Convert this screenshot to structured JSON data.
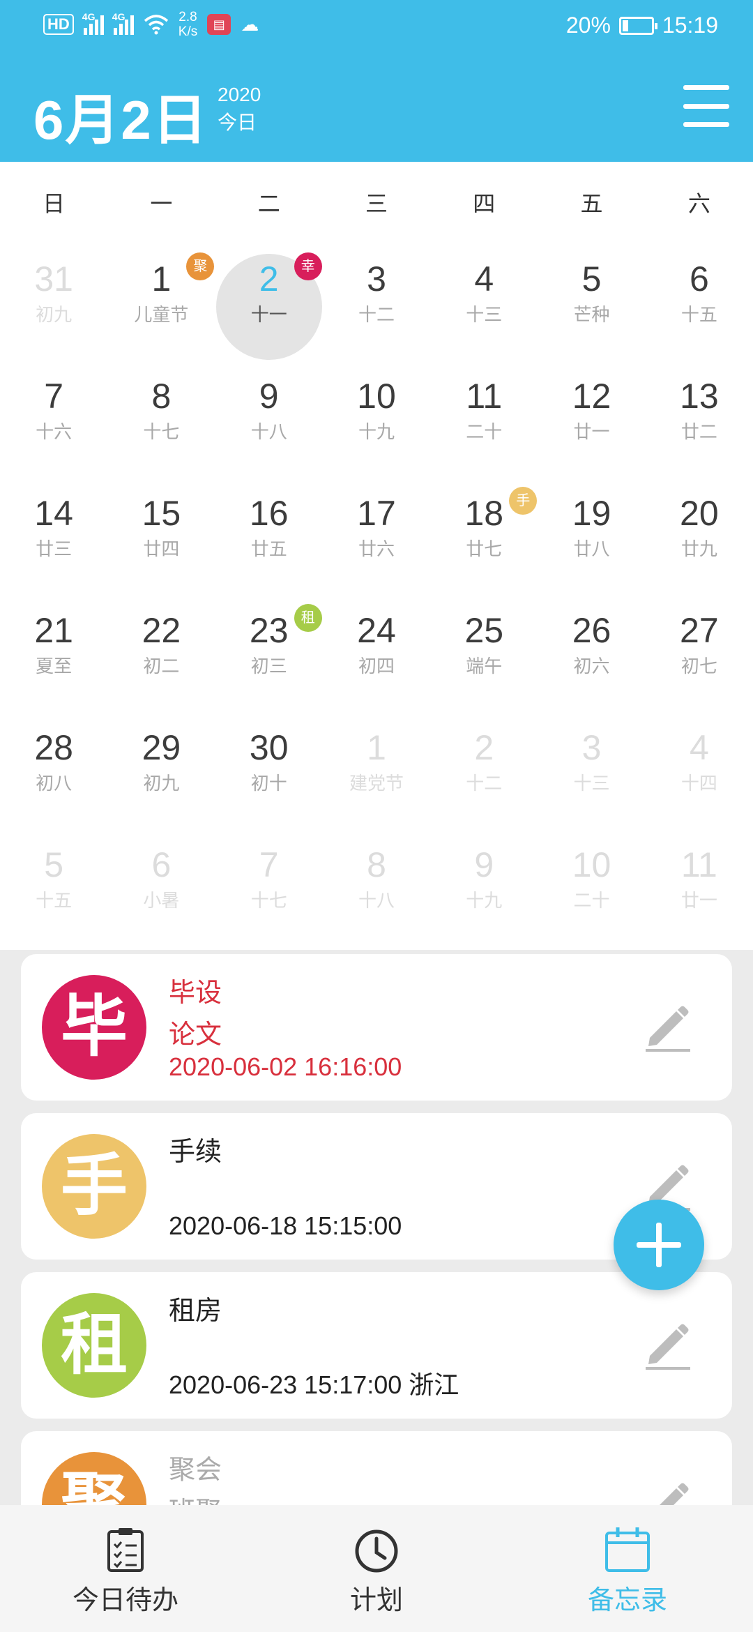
{
  "status_bar": {
    "hd": "HD",
    "net1": "4G",
    "net2": "4G",
    "speed_value": "2.8",
    "speed_unit": "K/s",
    "battery": "20%",
    "battery_level": 0.2,
    "time": "15:19"
  },
  "header": {
    "date": "6月2日",
    "year": "2020",
    "today_label": "今日"
  },
  "calendar": {
    "weekdays": [
      "日",
      "一",
      "二",
      "三",
      "四",
      "五",
      "六"
    ],
    "days": [
      {
        "num": "31",
        "lunar": "初九",
        "dim": true
      },
      {
        "num": "1",
        "lunar": "儿童节",
        "badge": "聚",
        "badge_color": "#e8933a"
      },
      {
        "num": "2",
        "lunar": "十一",
        "today": true,
        "badge": "幸",
        "badge_color": "#d81e5b"
      },
      {
        "num": "3",
        "lunar": "十二"
      },
      {
        "num": "4",
        "lunar": "十三"
      },
      {
        "num": "5",
        "lunar": "芒种"
      },
      {
        "num": "6",
        "lunar": "十五"
      },
      {
        "num": "7",
        "lunar": "十六"
      },
      {
        "num": "8",
        "lunar": "十七"
      },
      {
        "num": "9",
        "lunar": "十八"
      },
      {
        "num": "10",
        "lunar": "十九"
      },
      {
        "num": "11",
        "lunar": "二十"
      },
      {
        "num": "12",
        "lunar": "廿一"
      },
      {
        "num": "13",
        "lunar": "廿二"
      },
      {
        "num": "14",
        "lunar": "廿三"
      },
      {
        "num": "15",
        "lunar": "廿四"
      },
      {
        "num": "16",
        "lunar": "廿五"
      },
      {
        "num": "17",
        "lunar": "廿六"
      },
      {
        "num": "18",
        "lunar": "廿七",
        "badge": "手",
        "badge_color": "#eec46a"
      },
      {
        "num": "19",
        "lunar": "廿八"
      },
      {
        "num": "20",
        "lunar": "廿九"
      },
      {
        "num": "21",
        "lunar": "夏至"
      },
      {
        "num": "22",
        "lunar": "初二"
      },
      {
        "num": "23",
        "lunar": "初三",
        "badge": "租",
        "badge_color": "#a6cc48"
      },
      {
        "num": "24",
        "lunar": "初四"
      },
      {
        "num": "25",
        "lunar": "端午"
      },
      {
        "num": "26",
        "lunar": "初六"
      },
      {
        "num": "27",
        "lunar": "初七"
      },
      {
        "num": "28",
        "lunar": "初八"
      },
      {
        "num": "29",
        "lunar": "初九"
      },
      {
        "num": "30",
        "lunar": "初十"
      },
      {
        "num": "1",
        "lunar": "建党节",
        "dim": true
      },
      {
        "num": "2",
        "lunar": "十二",
        "dim": true
      },
      {
        "num": "3",
        "lunar": "十三",
        "dim": true
      },
      {
        "num": "4",
        "lunar": "十四",
        "dim": true
      },
      {
        "num": "5",
        "lunar": "十五",
        "dim": true
      },
      {
        "num": "6",
        "lunar": "小暑",
        "dim": true
      },
      {
        "num": "7",
        "lunar": "十七",
        "dim": true
      },
      {
        "num": "8",
        "lunar": "十八",
        "dim": true
      },
      {
        "num": "9",
        "lunar": "十九",
        "dim": true
      },
      {
        "num": "10",
        "lunar": "二十",
        "dim": true
      },
      {
        "num": "11",
        "lunar": "廿一",
        "dim": true
      }
    ]
  },
  "memos": [
    {
      "avatar": "毕",
      "color": "#d81e5b",
      "title": "毕设",
      "subtitle": "论文",
      "time": "2020-06-02  16:16:00",
      "urgent": true
    },
    {
      "avatar": "手",
      "color": "#eec46a",
      "title": "手续",
      "subtitle": "",
      "time": "2020-06-18  15:15:00"
    },
    {
      "avatar": "租",
      "color": "#a6cc48",
      "title": "租房",
      "subtitle": "",
      "time": "2020-06-23  15:17:00 浙江"
    },
    {
      "avatar": "聚",
      "color": "#e8933a",
      "title": "聚会",
      "subtitle": "班聚",
      "time": "",
      "done": true
    }
  ],
  "bottom_nav": [
    {
      "label": "今日待办",
      "icon": "checklist-icon",
      "active": false
    },
    {
      "label": "计划",
      "icon": "clock-icon",
      "active": false
    },
    {
      "label": "备忘录",
      "icon": "calendar-icon",
      "active": true
    }
  ],
  "colors": {
    "accent": "#3fbde8",
    "urgent": "#d8303d"
  }
}
